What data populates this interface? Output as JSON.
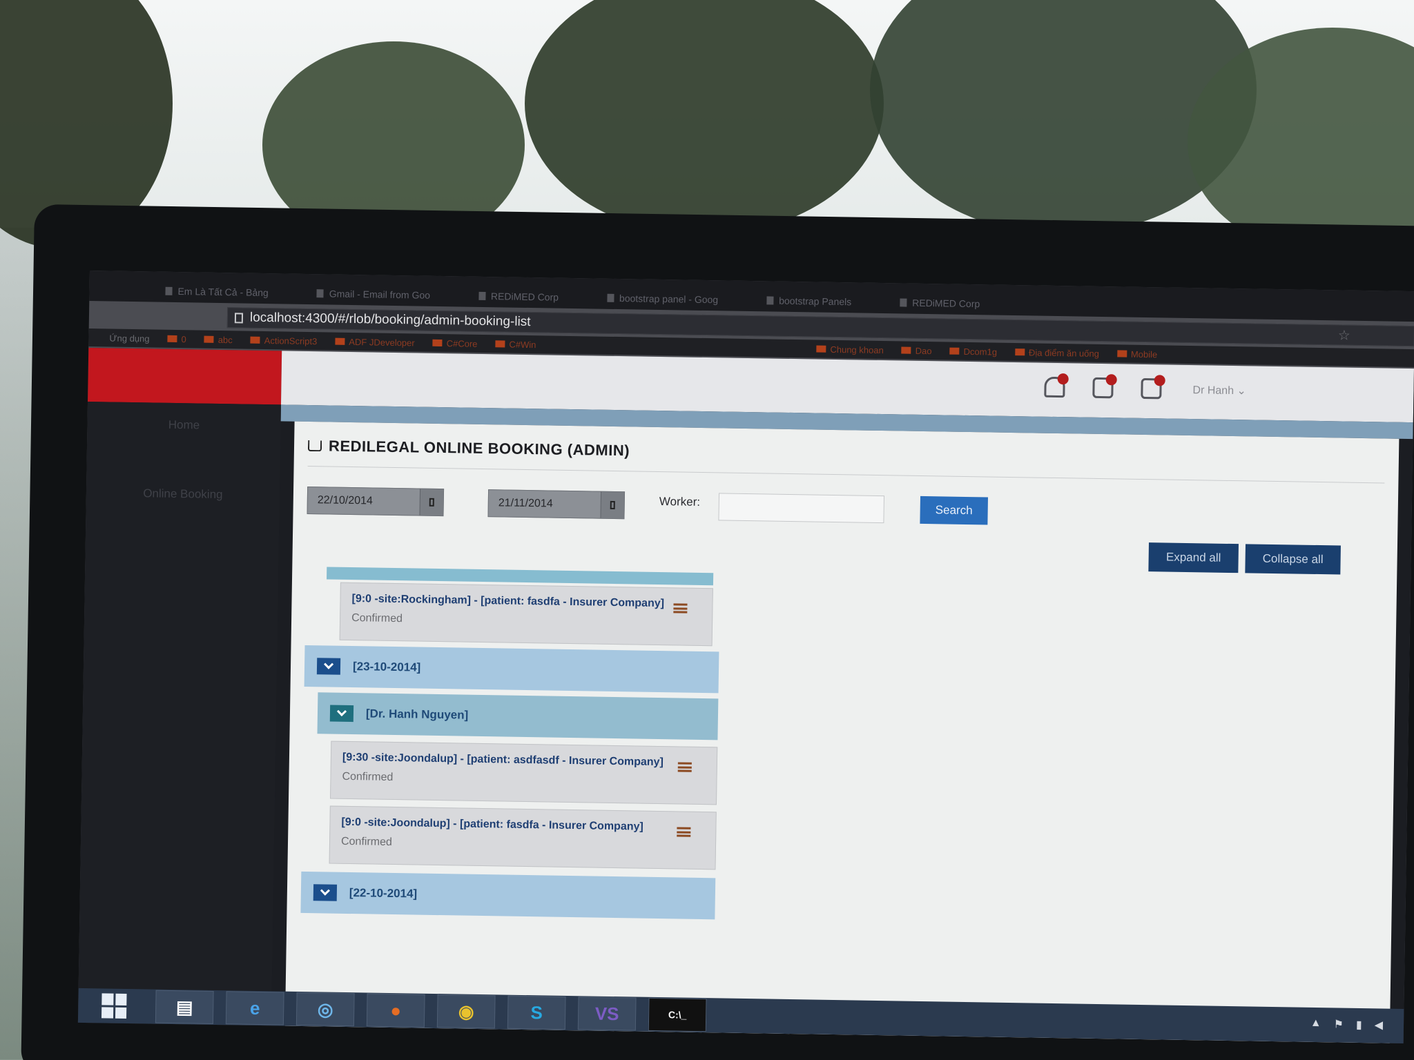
{
  "browser": {
    "tabs": [
      {
        "label": "Em Là Tất Cả - Bảng"
      },
      {
        "label": "Gmail - Email from Goo"
      },
      {
        "label": "REDiMED Corp"
      },
      {
        "label": "bootstrap panel - Goog"
      },
      {
        "label": "bootstrap Panels"
      },
      {
        "label": "REDiMED Corp"
      }
    ],
    "url": "localhost:4300/#/rlob/booking/admin-booking-list",
    "bookmarks_apps": "Ứng dụng",
    "bookmarks": [
      "0",
      "abc",
      "ActionScript3",
      "ADF JDeveloper",
      "C#Core",
      "C#Win",
      "Chung khoan",
      "Dao",
      "Dcom1g",
      "Địa điểm ăn uống",
      "Mobile"
    ]
  },
  "topbar": {
    "user_name": "Dr Hanh ⌄"
  },
  "sidebar": {
    "items": [
      {
        "label": "Home"
      },
      {
        "label": "Online Booking"
      }
    ]
  },
  "panel": {
    "title": "REDILEGAL ONLINE BOOKING (ADMIN)",
    "date_from": "22/10/2014",
    "date_to": "21/11/2014",
    "worker_label": "Worker:",
    "worker_value": "",
    "search_label": "Search",
    "expand_all_label": "Expand all",
    "collapse_all_label": "Collapse all"
  },
  "bookings_list": {
    "top_booking": {
      "title": "[9:0 -site:Rockingham] - [patient: fasdfa - Insurer Company]",
      "status": "Confirmed"
    },
    "day_group_1": "[23-10-2014]",
    "doctor_group_1": "[Dr. Hanh Nguyen]",
    "bookings": [
      {
        "title": "[9:30 -site:Joondalup] - [patient: asdfasdf - Insurer Company]",
        "status": "Confirmed"
      },
      {
        "title": "[9:0 -site:Joondalup] - [patient: fasdfa - Insurer Company]",
        "status": "Confirmed"
      }
    ],
    "day_group_2": "[22-10-2014]"
  },
  "taskbar": {
    "apps": [
      "start-icon",
      "file-explorer-icon",
      "internet-explorer-icon",
      "safari-icon",
      "firefox-icon",
      "chrome-icon",
      "skype-icon",
      "visual-studio-icon",
      "command-prompt-icon"
    ],
    "cmd_label": "C:\\_"
  },
  "colors": {
    "brand_red": "#c2171e",
    "primary_blue": "#2a6ebc",
    "dark_blue_button": "#1a3f6e",
    "group_blue": "#a6c7e0"
  }
}
